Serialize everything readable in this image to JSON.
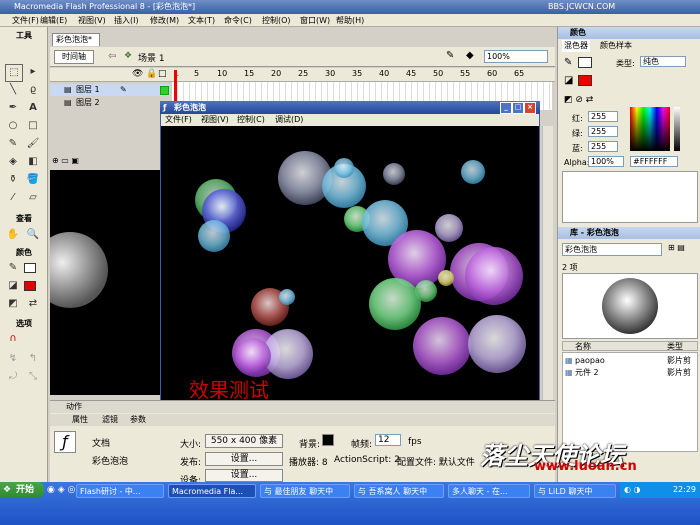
{
  "window": {
    "title": "Macromedia Flash Professional 8 - [彩色泡泡*]",
    "watermark": "BBS.JCWCN.COM"
  },
  "menu": [
    "文件(F)",
    "编辑(E)",
    "视图(V)",
    "插入(I)",
    "修改(M)",
    "文本(T)",
    "命令(C)",
    "控制(O)",
    "窗口(W)",
    "帮助(H)"
  ],
  "tools": {
    "header_tools": "工具",
    "header_view": "查看",
    "header_colors": "颜色",
    "header_options": "选项"
  },
  "document": {
    "tab": "彩色泡泡*",
    "timeline_label": "时间轴",
    "scene": "场景 1",
    "zoom": "100%",
    "layers": [
      "图层 1",
      "图层 2"
    ],
    "frame_numbers": [
      "1",
      "5",
      "10",
      "15",
      "20",
      "25",
      "30",
      "35",
      "40",
      "45",
      "50",
      "55",
      "60",
      "65"
    ]
  },
  "swf_window": {
    "title": "彩色泡泡",
    "menu": [
      "文件(F)",
      "视图(V)",
      "控制(C)",
      "调试(D)"
    ],
    "caption": "效果测试",
    "colors": {
      "caption": "#d00000"
    }
  },
  "properties": {
    "tabs": [
      "动作",
      "属性",
      "滤镜",
      "参数"
    ],
    "doc_label": "文档",
    "doc_name": "彩色泡泡",
    "size_label": "大小:",
    "size_value": "550 x 400 像素",
    "bg_label": "背景:",
    "fps_label": "帧频:",
    "fps_value": "12",
    "fps_unit": "fps",
    "publish_label": "发布:",
    "settings_btn": "设置...",
    "player_label": "播放器: 8",
    "as_label": "ActionScript: 2",
    "profile_label": "配置文件: 默认文件",
    "device_label": "设备:",
    "device_btn": "设置..."
  },
  "color_panel": {
    "header": "颜色",
    "tabs": [
      "混色器",
      "颜色样本"
    ],
    "type_label": "类型:",
    "type_value": "纯色",
    "red_label": "红:",
    "green_label": "绿:",
    "blue_label": "蓝:",
    "alpha_label": "Alpha:",
    "red": "255",
    "green": "255",
    "blue": "255",
    "alpha": "100%",
    "hex": "#FFFFFF"
  },
  "library": {
    "header": "库 - 彩色泡泡",
    "doc_select": "彩色泡泡",
    "count": "2 项",
    "col_name": "名称",
    "col_type": "类型",
    "items": [
      {
        "name": "paopao",
        "type": "影片剪"
      },
      {
        "name": "元件 2",
        "type": "影片剪"
      }
    ]
  },
  "taskbar": {
    "start": "开始",
    "lang": "标准",
    "tasks": [
      "Flash研讨 - 中...",
      "Macromedia Fla...",
      "与 最佳朋友 聊天中",
      "与 吾系窝人 聊天中",
      "多人聊天 - 在...",
      "与 LiLD 聊天中"
    ],
    "clock": "22:29"
  },
  "forum_watermark": {
    "name": "落尘天使论坛",
    "url": "www.luoan.cn"
  }
}
